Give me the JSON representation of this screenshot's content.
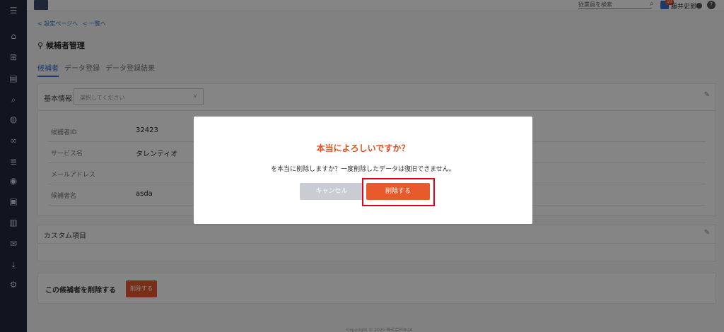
{
  "sidebar": {
    "icons": [
      "menu-icon",
      "home-icon",
      "org-chart-icon",
      "document-icon",
      "search-icon",
      "chat-icon",
      "link-icon",
      "list-chart-icon",
      "globe-icon",
      "id-card-icon",
      "book-icon",
      "mail-icon",
      "download-icon",
      "user-settings-icon"
    ]
  },
  "topbar": {
    "search_placeholder": "従業員を検索",
    "badge_count": "10",
    "user_name": "藤井史郎",
    "help_label": "?"
  },
  "breadcrumb": [
    "< 設定ページへ",
    "< 一覧へ"
  ],
  "page": {
    "title": "候補者管理",
    "tabs": [
      "候補者",
      "データ登録",
      "データ登録結果"
    ]
  },
  "basic_info": {
    "title": "基本情報",
    "select_placeholder": "選択してください",
    "fields": [
      {
        "label": "候補者ID",
        "value": "32423"
      },
      {
        "label": "サービス名",
        "value": "タレンティオ"
      },
      {
        "label": "メールアドレス",
        "value": ""
      },
      {
        "label": "候補者名",
        "value": "asda"
      }
    ]
  },
  "custom": {
    "title": "カスタム項目"
  },
  "delete_section": {
    "label": "この候補者を削除する",
    "button": "削除する"
  },
  "footer": {
    "text": "Copyright © 2025 株式会社BizA"
  },
  "modal": {
    "title": "本当によろしいですか？",
    "message": "を本当に削除しますか？一度削除したデータは復旧できません。",
    "cancel": "キャンセル",
    "confirm": "削除する"
  },
  "colors": {
    "accent": "#e85a2c",
    "highlight": "#e3001b",
    "link": "#2f6fd1",
    "sidebar": "#1f2a3c"
  }
}
